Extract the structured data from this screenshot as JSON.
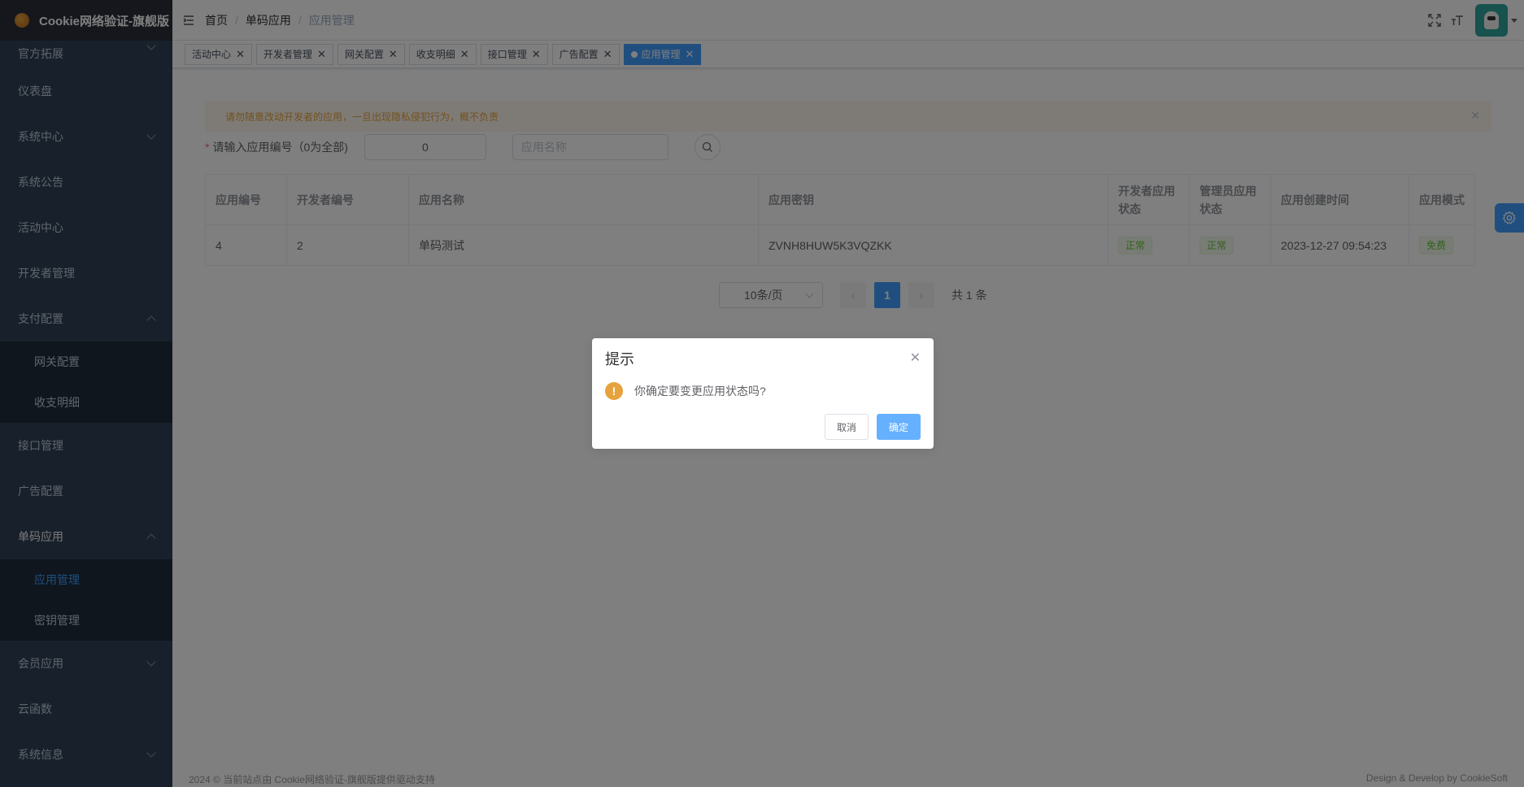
{
  "app": {
    "title": "Cookie网络验证-旗舰版"
  },
  "sidebar": {
    "items": [
      {
        "label": "官方拓展",
        "expand": "down"
      },
      {
        "label": "仪表盘"
      },
      {
        "label": "系统中心",
        "expand": "down"
      },
      {
        "label": "系统公告"
      },
      {
        "label": "活动中心"
      },
      {
        "label": "开发者管理"
      },
      {
        "label": "支付配置",
        "expand": "up"
      },
      {
        "label": "网关配置"
      },
      {
        "label": "收支明细"
      },
      {
        "label": "接口管理"
      },
      {
        "label": "广告配置"
      },
      {
        "label": "单码应用",
        "expand": "up"
      },
      {
        "label": "应用管理"
      },
      {
        "label": "密钥管理"
      },
      {
        "label": "会员应用",
        "expand": "down"
      },
      {
        "label": "云函数"
      },
      {
        "label": "系统信息",
        "expand": "down"
      }
    ]
  },
  "breadcrumb": [
    "首页",
    "单码应用",
    "应用管理"
  ],
  "tags": [
    "活动中心",
    "开发者管理",
    "网关配置",
    "收支明细",
    "接口管理",
    "广告配置",
    "应用管理"
  ],
  "alert": {
    "text": "请勿随意改动开发者的应用，一旦出现隐私侵犯行为，概不负责"
  },
  "search": {
    "label": "请输入应用编号（0为全部)",
    "app_id_value": "0",
    "name_placeholder": "应用名称"
  },
  "table": {
    "headers": [
      "应用编号",
      "开发者编号",
      "应用名称",
      "应用密钥",
      "开发者应用状态",
      "管理员应用状态",
      "应用创建时间",
      "应用模式"
    ],
    "rows": [
      [
        "4",
        "2",
        "单码测试",
        "ZVNH8HUW5K3VQZKK",
        "正常",
        "正常",
        "2023-12-27 09:54:23",
        "免费"
      ]
    ]
  },
  "pagination": {
    "page_size": "10条/页",
    "current": "1",
    "total": "共 1 条"
  },
  "footer": {
    "left": "2024 © 当前站点由 Cookie网络验证-旗舰版提供驱动支持",
    "right": "Design & Develop by CookieSoft"
  },
  "dialog": {
    "title": "提示",
    "message": "你确定要变更应用状态吗?",
    "cancel": "取消",
    "confirm": "确定"
  },
  "colors": {
    "sidebar": "#304156",
    "primary": "#409eff",
    "success": "#67c23a",
    "warning": "#e6a23c"
  }
}
